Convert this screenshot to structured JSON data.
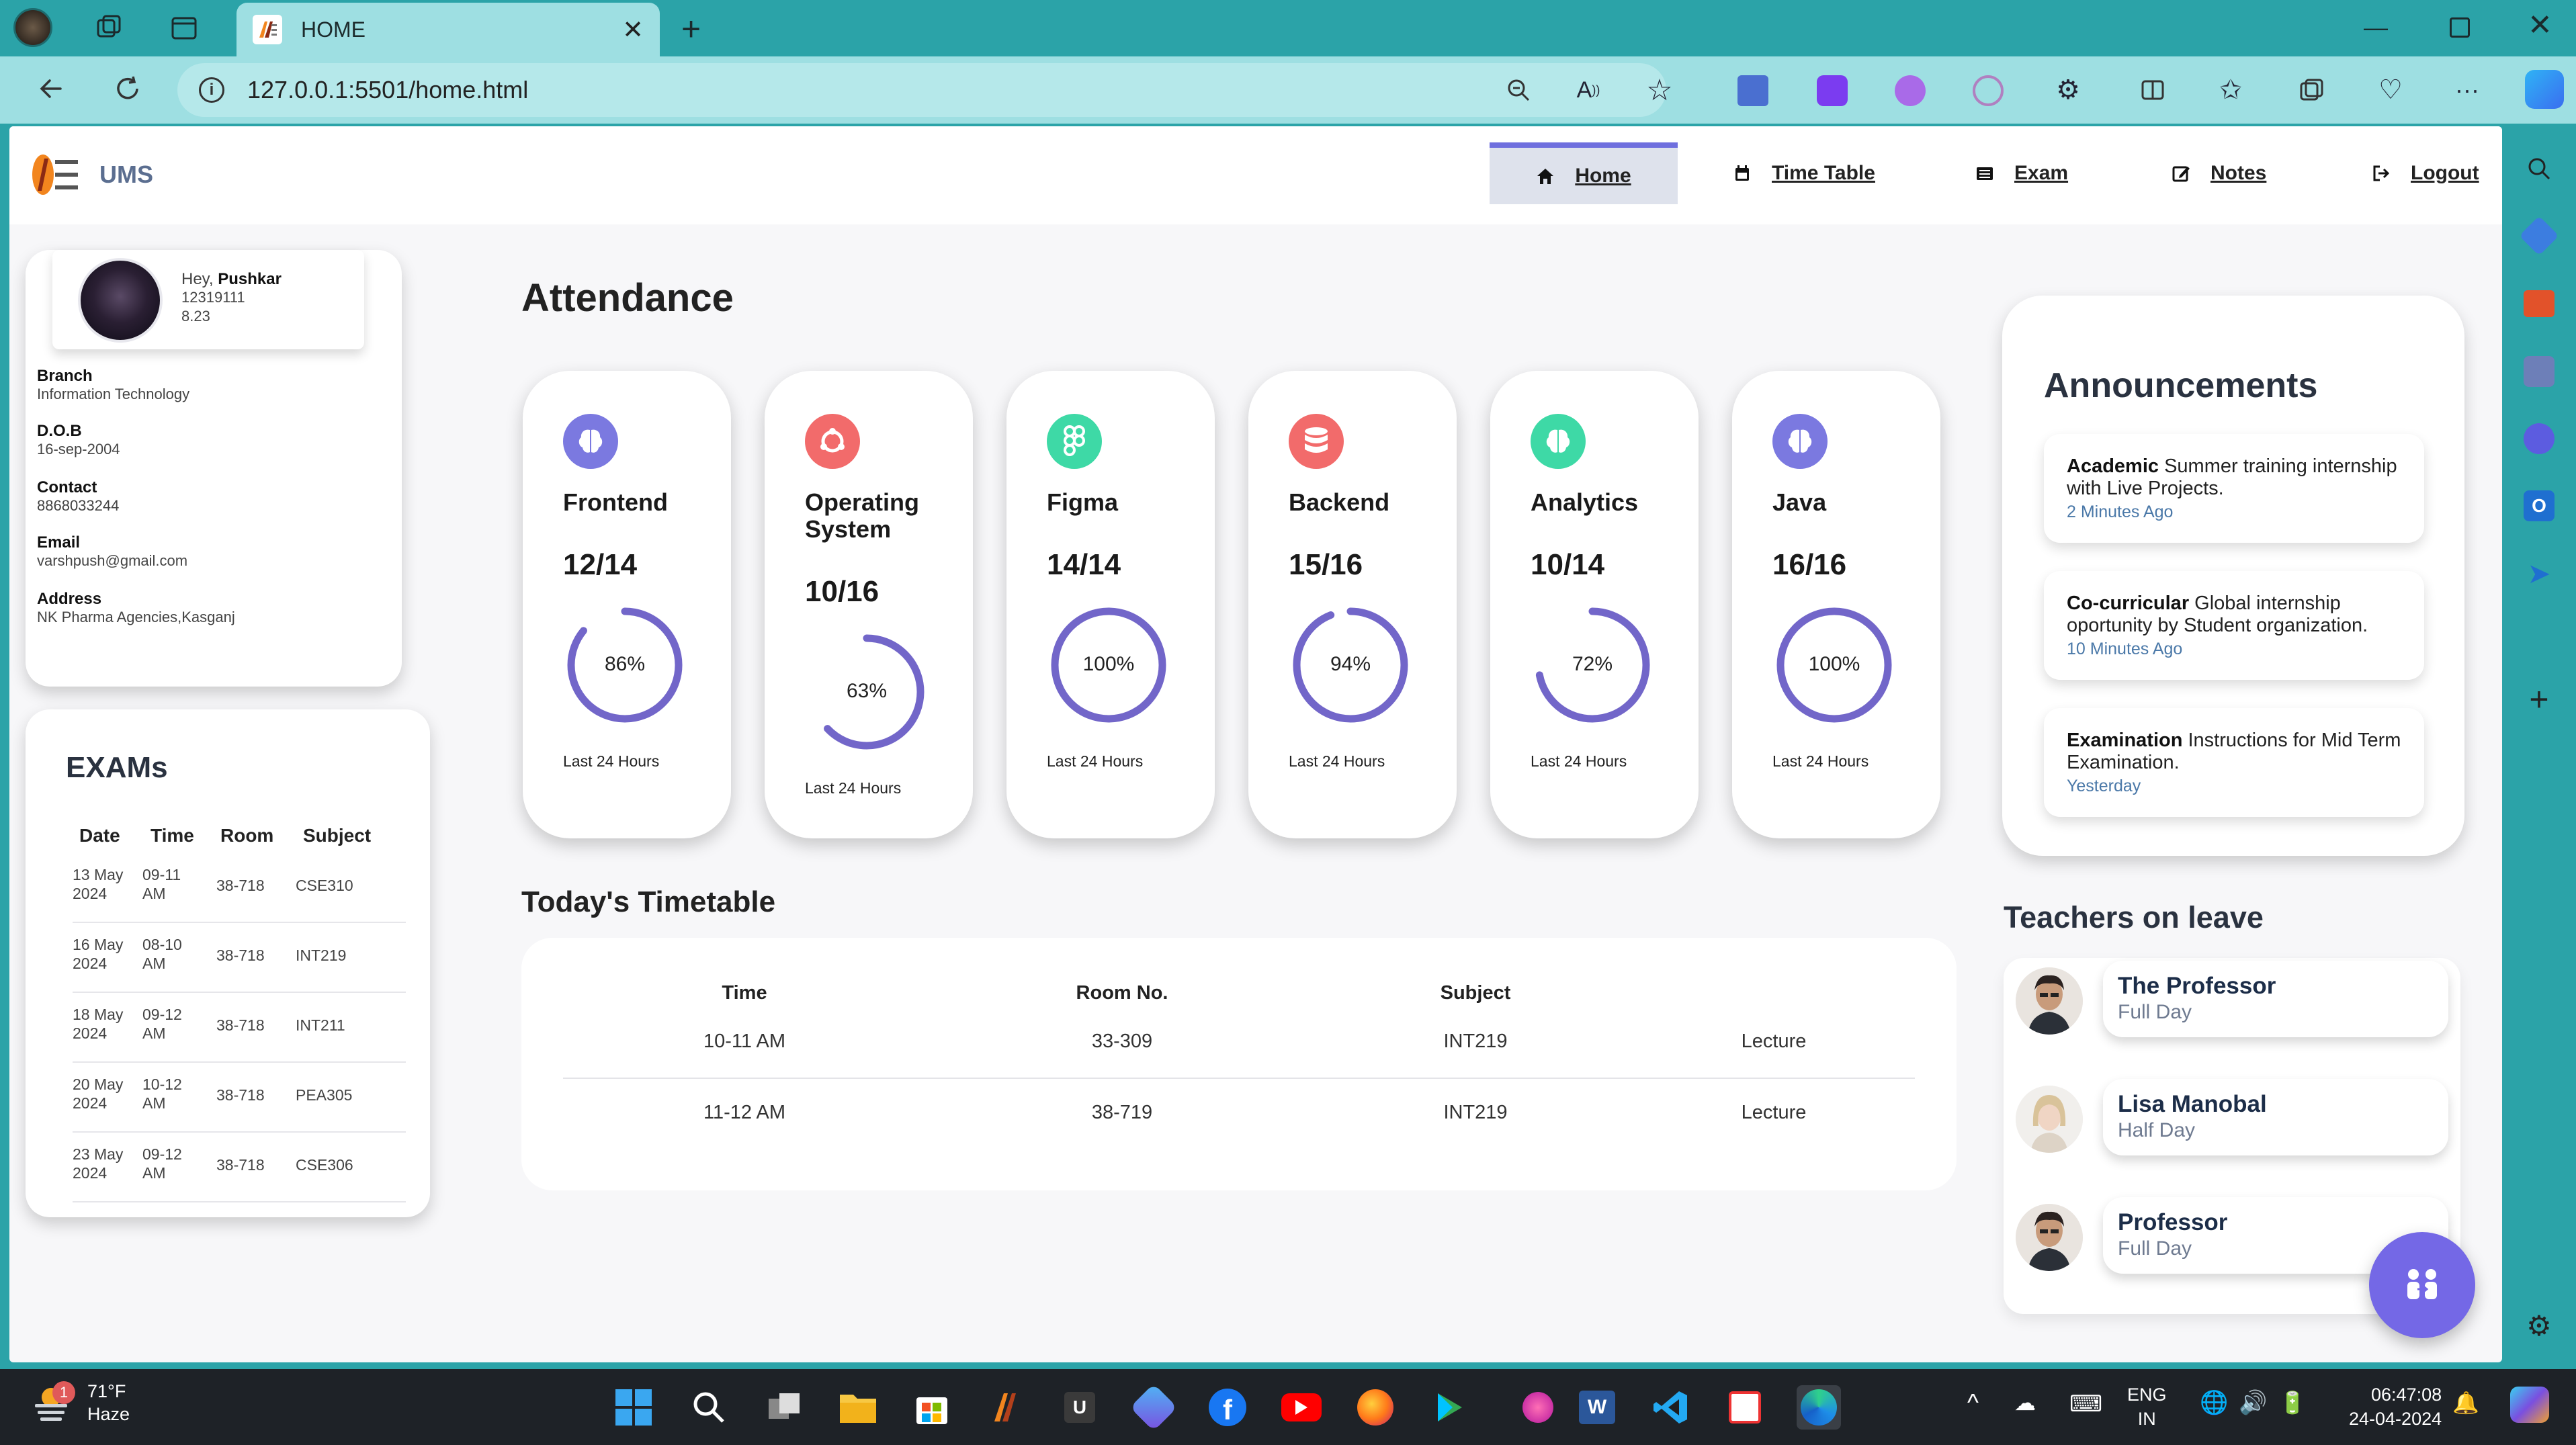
{
  "browser": {
    "tab_title": "HOME",
    "url": "127.0.0.1:5501/home.html"
  },
  "app": {
    "logo_text": "UMS",
    "nav": [
      {
        "label": "Home",
        "icon": "home-icon"
      },
      {
        "label": "Time Table",
        "icon": "calendar-icon"
      },
      {
        "label": "Exam",
        "icon": "list-icon"
      },
      {
        "label": "Notes",
        "icon": "edit-icon"
      },
      {
        "label": "Logout",
        "icon": "logout-icon"
      }
    ]
  },
  "profile": {
    "greeting": "Hey,",
    "name": "Pushkar",
    "id": "12319111",
    "cgpa": "8.23",
    "fields": [
      {
        "label": "Branch",
        "value": "Information Technology"
      },
      {
        "label": "D.O.B",
        "value": "16-sep-2004"
      },
      {
        "label": "Contact",
        "value": "8868033244"
      },
      {
        "label": "Email",
        "value": "varshpush@gmail.com"
      },
      {
        "label": "Address",
        "value": "NK Pharma Agencies,Kasganj"
      }
    ]
  },
  "exams": {
    "title": "EXAMs",
    "headers": [
      "Date",
      "Time",
      "Room",
      "Subject"
    ],
    "rows": [
      {
        "date1": "13 May",
        "date2": "2024",
        "time1": "09-11",
        "time2": "AM",
        "room": "38-718",
        "subject": "CSE310"
      },
      {
        "date1": "16 May",
        "date2": "2024",
        "time1": "08-10",
        "time2": "AM",
        "room": "38-718",
        "subject": "INT219"
      },
      {
        "date1": "18 May",
        "date2": "2024",
        "time1": "09-12",
        "time2": "AM",
        "room": "38-718",
        "subject": "INT211"
      },
      {
        "date1": "20 May",
        "date2": "2024",
        "time1": "10-12",
        "time2": "AM",
        "room": "38-718",
        "subject": "PEA305"
      },
      {
        "date1": "23 May",
        "date2": "2024",
        "time1": "09-12",
        "time2": "AM",
        "room": "38-718",
        "subject": "CSE306"
      }
    ]
  },
  "attendance": {
    "title": "Attendance",
    "courses": [
      {
        "name": "Frontend",
        "count": "12/14",
        "percent_label": "86%",
        "percent": 86,
        "period": "Last 24 Hours",
        "icon": "brain-icon",
        "color": "#7b79e0"
      },
      {
        "name": "Operating System",
        "count": "10/16",
        "percent_label": "63%",
        "percent": 63,
        "period": "Last 24 Hours",
        "icon": "ubuntu-icon",
        "color": "#f26b6b"
      },
      {
        "name": "Figma",
        "count": "14/14",
        "percent_label": "100%",
        "percent": 100,
        "period": "Last 24 Hours",
        "icon": "figma-icon",
        "color": "#3ed9a6"
      },
      {
        "name": "Backend",
        "count": "15/16",
        "percent_label": "94%",
        "percent": 94,
        "period": "Last 24 Hours",
        "icon": "database-icon",
        "color": "#f26b6b"
      },
      {
        "name": "Analytics",
        "count": "10/14",
        "percent_label": "72%",
        "percent": 72,
        "period": "Last 24 Hours",
        "icon": "brain-icon",
        "color": "#3ed9a6"
      },
      {
        "name": "Java",
        "count": "16/16",
        "percent_label": "100%",
        "percent": 100,
        "period": "Last 24 Hours",
        "icon": "brain-icon",
        "color": "#7b79e0"
      }
    ],
    "ring_color": "#7266c9"
  },
  "timetable": {
    "title": "Today's Timetable",
    "headers": [
      "Time",
      "Room No.",
      "Subject"
    ],
    "rows": [
      {
        "time": "10-11 AM",
        "room": "33-309",
        "subject": "INT219",
        "type": "Lecture"
      },
      {
        "time": "11-12 AM",
        "room": "38-719",
        "subject": "INT219",
        "type": "Lecture"
      }
    ]
  },
  "announcements": {
    "title": "Announcements",
    "items": [
      {
        "tag": "Academic",
        "text": "Summer training internship with Live Projects.",
        "time": "2 Minutes Ago"
      },
      {
        "tag": "Co-curricular",
        "text": "Global internship oportunity by Student organization.",
        "time": "10 Minutes Ago"
      },
      {
        "tag": "Examination",
        "text": "Instructions for Mid Term Examination.",
        "time": "Yesterday"
      }
    ]
  },
  "teachers_on_leave": {
    "title": "Teachers on leave",
    "items": [
      {
        "name": "The Professor",
        "duration": "Full Day"
      },
      {
        "name": "Lisa Manobal",
        "duration": "Half Day"
      },
      {
        "name": "Professor",
        "duration": "Full Day"
      }
    ]
  },
  "taskbar": {
    "weather_temp": "71°F",
    "weather_desc": "Haze",
    "weather_badge": "1",
    "lang1": "ENG",
    "lang2": "IN",
    "time": "06:47:08",
    "date": "24-04-2024"
  }
}
